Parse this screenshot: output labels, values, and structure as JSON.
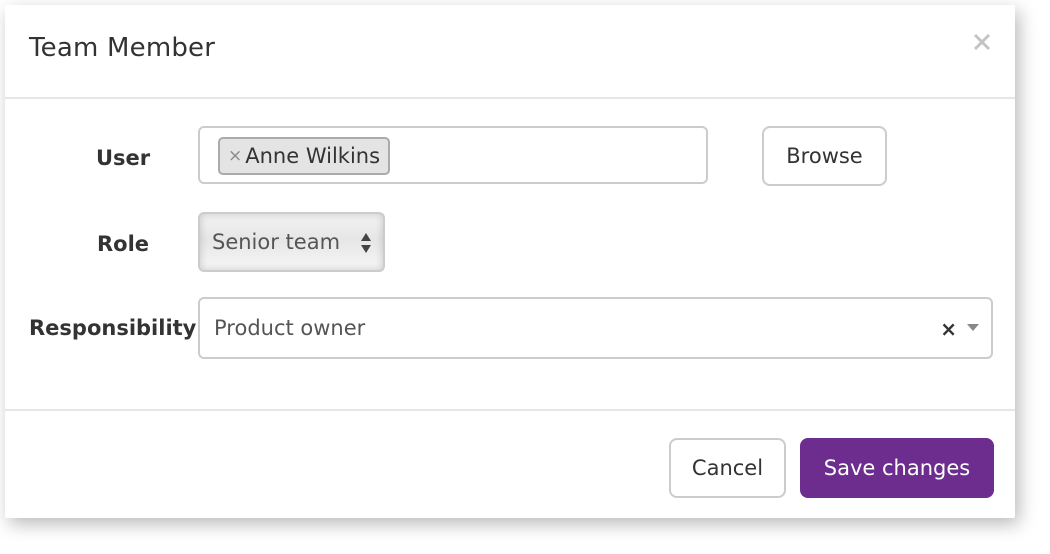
{
  "dialog": {
    "title": "Team Member",
    "close_icon": "close-icon"
  },
  "form": {
    "user": {
      "label": "User",
      "selected_tags": [
        {
          "label": "Anne Wilkins",
          "remove_symbol": "×"
        }
      ],
      "browse_label": "Browse"
    },
    "role": {
      "label": "Role",
      "selected": "Senior team"
    },
    "responsibility": {
      "label": "Responsibility",
      "selected": "Product owner",
      "clear_symbol": "×"
    }
  },
  "footer": {
    "cancel_label": "Cancel",
    "save_label": "Save changes"
  },
  "colors": {
    "primary": "#6c2d8f",
    "border": "#cccccc",
    "tag_bg": "#e4e4e4"
  }
}
